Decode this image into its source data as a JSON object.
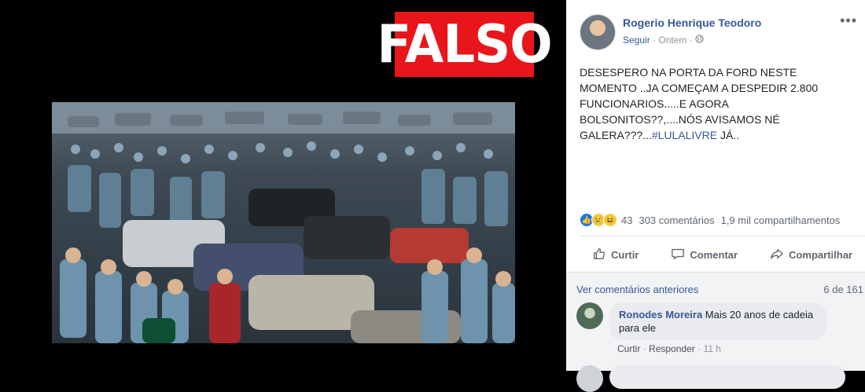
{
  "stamp": {
    "label": "FALSO",
    "color": "#e8151b"
  },
  "post": {
    "author": "Rogerio Henrique Teodoro",
    "follow_label": "Seguir",
    "time": "Ontem",
    "text_main": "DESESPERO NA PORTA DA FORD NESTE\nMOMENTO ..JA COMEÇAM A DESPEDIR 2.800\nFUNCIONARIOS.....E AGORA\nBOLSONITOS??,....NÓS AVISAMOS NÉ\nGALERA???...",
    "hashtag": "#LULALIVRE",
    "text_tail": " JÁ..",
    "more_icon": "more-options-icon"
  },
  "stats": {
    "reaction_count": "43",
    "comments": "303 comentários",
    "shares": "1,9 mil compartilhamentos",
    "reactions": [
      "like-icon",
      "sad-icon",
      "haha-icon"
    ]
  },
  "actions": {
    "like": "Curtir",
    "comment": "Comentar",
    "share": "Compartilhar"
  },
  "comments_section": {
    "prev_link": "Ver comentários anteriores",
    "pager": "6 de 161",
    "comment": {
      "author": "Ronodes Moreira",
      "text": " Mais 20 anos de cadeia para ele",
      "like_label": "Curtir",
      "reply_label": "Responder",
      "time": "11 h"
    }
  }
}
